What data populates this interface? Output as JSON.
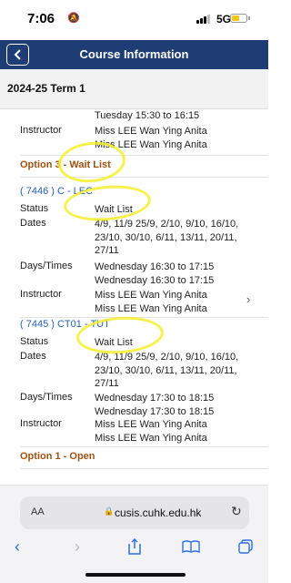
{
  "status_bar": {
    "time": "7:06",
    "carrier": "5G",
    "battery_color": "#f5c518",
    "signal_color": "#000000"
  },
  "nav": {
    "title": "Course Information",
    "bg_color": "#1f3d75",
    "back_icon": "chevron-left-icon"
  },
  "term": {
    "title": "2024-25 Term 1"
  },
  "top_partial": {
    "time_line": "Tuesday 15:30 to 16:15",
    "instructor_label": "Instructor",
    "instructors": [
      "Miss LEE Wan Ying Anita",
      "Miss LEE Wan Ying Anita"
    ]
  },
  "option3": {
    "label": "Option 3 - Wait List",
    "color": "#a0520f"
  },
  "sections": [
    {
      "title": "( 7446 ) C - LEC",
      "status_label": "Status",
      "status": "Wait List",
      "dates_label": "Dates",
      "dates": [
        "4/9, 11/9 25/9, 2/10, 9/10, 16/10,",
        "23/10, 30/10, 6/11, 13/11, 20/11,",
        "27/11"
      ],
      "days_label": "Days/Times",
      "times": [
        "Wednesday 16:30 to 17:15",
        "Wednesday 16:30 to 17:15"
      ],
      "instructor_label": "Instructor",
      "instructors": [
        "Miss LEE Wan Ying Anita",
        "Miss LEE Wan Ying Anita"
      ]
    },
    {
      "title": "( 7445 ) CT01 - TUT",
      "status_label": "Status",
      "status": "Wait List",
      "dates_label": "Dates",
      "dates": [
        "4/9, 11/9 25/9, 2/10, 9/10, 16/10,",
        "23/10, 30/10, 6/11, 13/11, 20/11,",
        "27/11"
      ],
      "days_label": "Days/Times",
      "times": [
        "Wednesday 17:30 to 18:15",
        "Wednesday 17:30 to 18:15"
      ],
      "instructor_label": "Instructor",
      "instructors": [
        "Miss LEE Wan Ying Anita",
        "Miss LEE Wan Ying Anita"
      ]
    }
  ],
  "option1": {
    "label": "Option 1 - Open",
    "color": "#a0520f"
  },
  "section_title_color": "#2a62b0",
  "highlight_color": "#f4ef2c",
  "browser": {
    "aa_label": "AA",
    "url": "cusis.cuhk.edu.hk",
    "toolbar": [
      "back-icon",
      "forward-icon",
      "share-icon",
      "bookmarks-icon",
      "tabs-icon"
    ],
    "accent": "#2f6fe0"
  }
}
